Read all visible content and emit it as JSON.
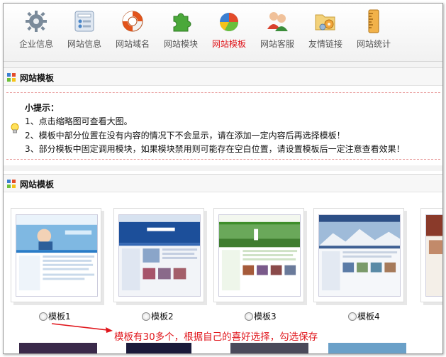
{
  "nav": {
    "items": [
      {
        "label": "企业信息",
        "icon": "gear-icon"
      },
      {
        "label": "网站信息",
        "icon": "control-panel-icon"
      },
      {
        "label": "网站域名",
        "icon": "lifebuoy-icon"
      },
      {
        "label": "网站模块",
        "icon": "puzzle-icon"
      },
      {
        "label": "网站模板",
        "icon": "pie-chart-icon",
        "active": true
      },
      {
        "label": "网站客服",
        "icon": "users-icon"
      },
      {
        "label": "友情链接",
        "icon": "folder-gears-icon"
      },
      {
        "label": "网站统计",
        "icon": "ruler-stats-icon"
      }
    ]
  },
  "section1": {
    "title": "网站模板"
  },
  "tips": {
    "title": "小提示：",
    "lines": [
      "1、点击缩略图可查看大图。",
      "2、模板中部分位置在没有内容的情况下不会显示，请在添加一定内容后再选择模板！",
      "3、部分模板中固定调用模块，如果模块禁用则可能存在空白位置，请设置模板后一定注意查看效果！"
    ]
  },
  "section2": {
    "title": "网站模板"
  },
  "templates": [
    {
      "label": "模板1"
    },
    {
      "label": "模板2"
    },
    {
      "label": "模板3"
    },
    {
      "label": "模板4"
    }
  ],
  "annotation": "模板有30多个，根据自己的喜好选择，勾选保存",
  "colors": {
    "active_nav": "#e0151b",
    "annotation": "#e0151b",
    "dashed_border": "#e89a9a"
  }
}
